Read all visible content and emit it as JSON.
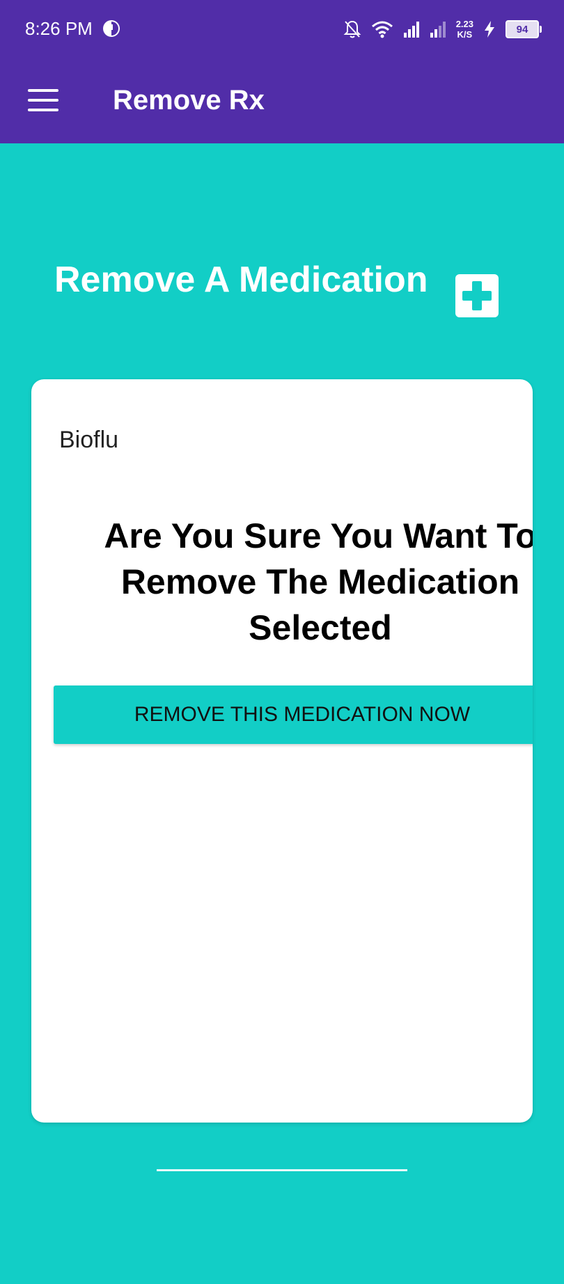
{
  "status_bar": {
    "time": "8:26 PM",
    "net_speed_value": "2.23",
    "net_speed_unit": "K/S",
    "battery": "94",
    "icons": [
      "app-clock-icon",
      "notification-off-icon",
      "wifi-icon",
      "signal-icon",
      "signal-icon",
      "charging-icon",
      "battery-icon"
    ]
  },
  "app_bar": {
    "title": "Remove Rx",
    "menu_icon": "hamburger-menu-icon"
  },
  "page": {
    "heading": "Remove A Medication",
    "add_icon": "plus-icon"
  },
  "card": {
    "medication_name": "Bioflu",
    "confirm_text": "Are You Sure You Want To\nRemove The Medication\nSelected",
    "remove_button_label": "REMOVE THIS MEDICATION NOW"
  },
  "colors": {
    "primary": "#512DA8",
    "accent": "#12CEC6",
    "card": "#FFFFFF"
  }
}
